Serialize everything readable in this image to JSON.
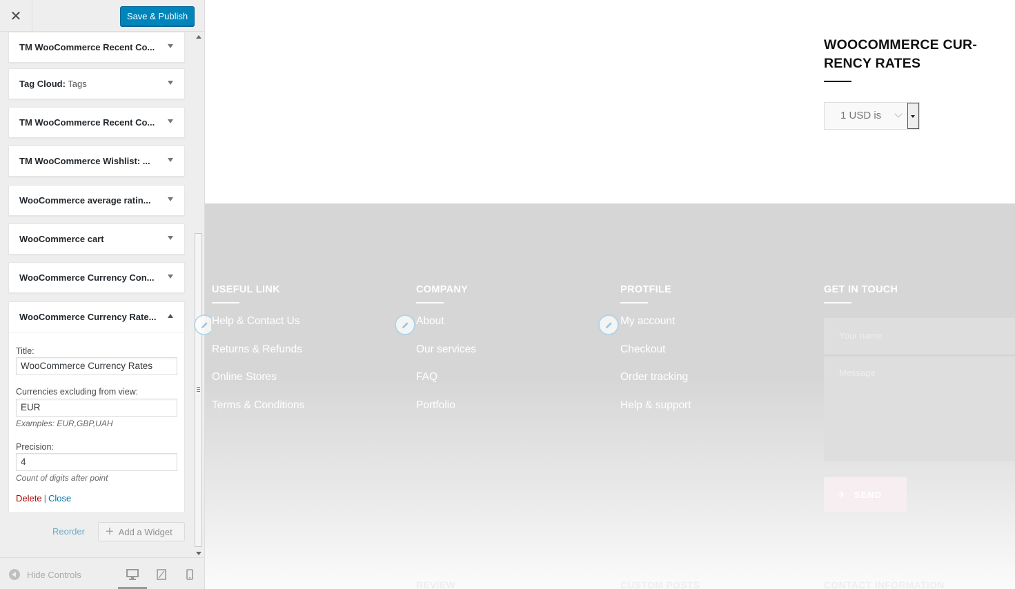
{
  "header": {
    "close_glyph": "✕",
    "publish_label": "Save & Publish"
  },
  "widgets": [
    {
      "title": "TM WooCommerce Recent Co...",
      "subtitle": ""
    },
    {
      "title": "Tag Cloud:",
      "subtitle": " Tags"
    },
    {
      "title": "TM WooCommerce Recent Co...",
      "subtitle": ""
    },
    {
      "title": "TM WooCommerce Wishlist: ...",
      "subtitle": ""
    },
    {
      "title": "WooCommerce average ratin...",
      "subtitle": ""
    },
    {
      "title": "WooCommerce cart",
      "subtitle": ""
    },
    {
      "title": "WooCommerce Currency Con...",
      "subtitle": ""
    },
    {
      "title": "WooCommerce Currency Rate...",
      "subtitle": ""
    }
  ],
  "form": {
    "title_label": "Title:",
    "title_value": "WooCommerce Currency Rates",
    "exclude_label": "Currencies excluding from view:",
    "exclude_value": "EUR",
    "exclude_desc": "Examples: EUR,GBP,UAH",
    "precision_label": "Precision:",
    "precision_value": "4",
    "precision_desc": "Count of digits after point",
    "delete_label": "Delete",
    "separator": "|",
    "close_label": "Close"
  },
  "widget_actions": {
    "reorder_label": "Reorder",
    "add_label": "Add a Widget"
  },
  "footer_controls": {
    "hide_label": "Hide Controls"
  },
  "preview": {
    "rates_heading_line1": "WOOCOMMERCE CUR-",
    "rates_heading_line2": "RENCY RATES",
    "rates_select_value": "1 USD is",
    "columns": [
      {
        "title": "USEFUL LINK",
        "links": [
          "Help & Contact Us",
          "Returns & Refunds",
          "Online Stores",
          "Terms & Conditions"
        ]
      },
      {
        "title": "COMPANY",
        "links": [
          "About",
          "Our services",
          "FAQ",
          "Portfolio"
        ]
      },
      {
        "title": "PROTFILE",
        "links": [
          "My account",
          "Checkout",
          "Order tracking",
          "Help & support"
        ]
      },
      {
        "title": "GET IN TOUCH",
        "links": []
      }
    ],
    "contact": {
      "name_placeholder": "Your name",
      "message_placeholder": "Message",
      "send_label": "SEND"
    },
    "bottom_titles": [
      "REVIEW",
      "CUSTOM POSTS",
      "CONTACT INFORMATION"
    ]
  },
  "colors": {
    "publish_blue": "#0085ba",
    "link_blue": "#0073aa",
    "delete_red": "#aa0000",
    "footer_gray": "#d6d6d6"
  }
}
